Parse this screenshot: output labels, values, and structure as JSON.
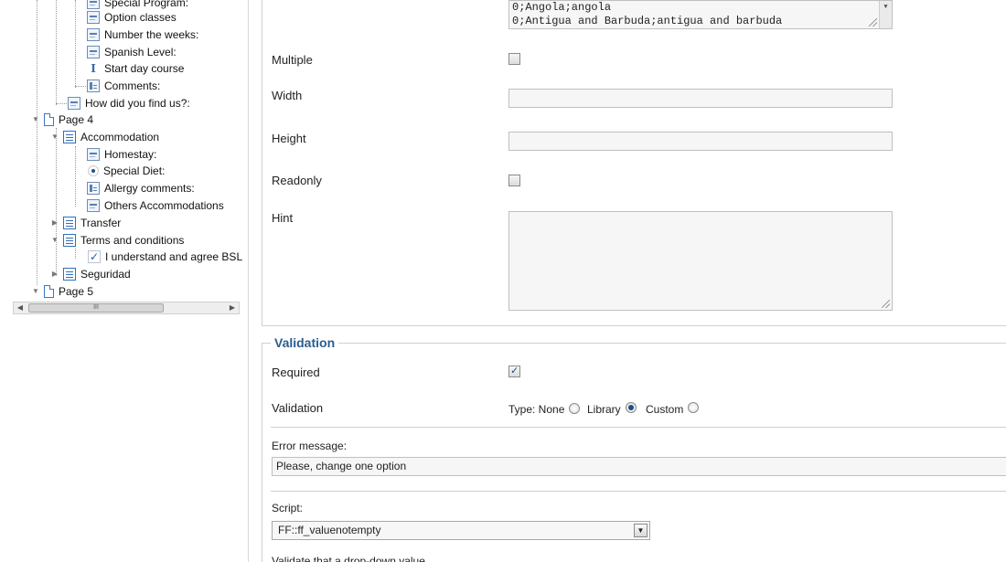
{
  "tree": {
    "items": [
      {
        "label": "Special Program:",
        "icon": "field-icon"
      },
      {
        "label": "Option classes",
        "icon": "field-icon"
      },
      {
        "label": "Number the weeks:",
        "icon": "field-icon"
      },
      {
        "label": "Spanish Level:",
        "icon": "field-icon"
      },
      {
        "label": "Start day course",
        "icon": "date-icon"
      },
      {
        "label": "Comments:",
        "icon": "textarea-icon"
      },
      {
        "label": "How did you find us?:",
        "icon": "field-icon"
      },
      {
        "label": "Page 4",
        "icon": "page-icon"
      },
      {
        "label": "Accommodation",
        "icon": "group-icon"
      },
      {
        "label": "Homestay:",
        "icon": "field-icon"
      },
      {
        "label": "Special Diet:",
        "icon": "radio-icon"
      },
      {
        "label": "Allergy comments:",
        "icon": "textarea-icon"
      },
      {
        "label": "Others Accommodations",
        "icon": "field-icon"
      },
      {
        "label": "Transfer",
        "icon": "group-icon"
      },
      {
        "label": "Terms and conditions",
        "icon": "group-icon"
      },
      {
        "label": "I understand and agree BSL",
        "icon": "checkbox-icon"
      },
      {
        "label": "Seguridad",
        "icon": "group-icon"
      },
      {
        "label": "Page 5",
        "icon": "page-icon"
      }
    ],
    "scroll_thumb": "III"
  },
  "props": {
    "options_lines": [
      "0;Angola;angola",
      "0;Antigua and Barbuda;antigua and barbuda"
    ],
    "multiple_label": "Multiple",
    "width_label": "Width",
    "width_value": "",
    "height_label": "Height",
    "height_value": "",
    "readonly_label": "Readonly",
    "hint_label": "Hint",
    "hint_value": ""
  },
  "validation": {
    "legend": "Validation",
    "required_label": "Required",
    "validation_label": "Validation",
    "type_label": "Type: None",
    "library_label": "Library",
    "custom_label": "Custom",
    "selected_type": "Library",
    "error_label": "Error message:",
    "error_value": "Please, change one option",
    "script_label": "Script:",
    "script_value": "FF::ff_valuenotempty",
    "cut_off_text": "Validate that a drop-down value..."
  }
}
